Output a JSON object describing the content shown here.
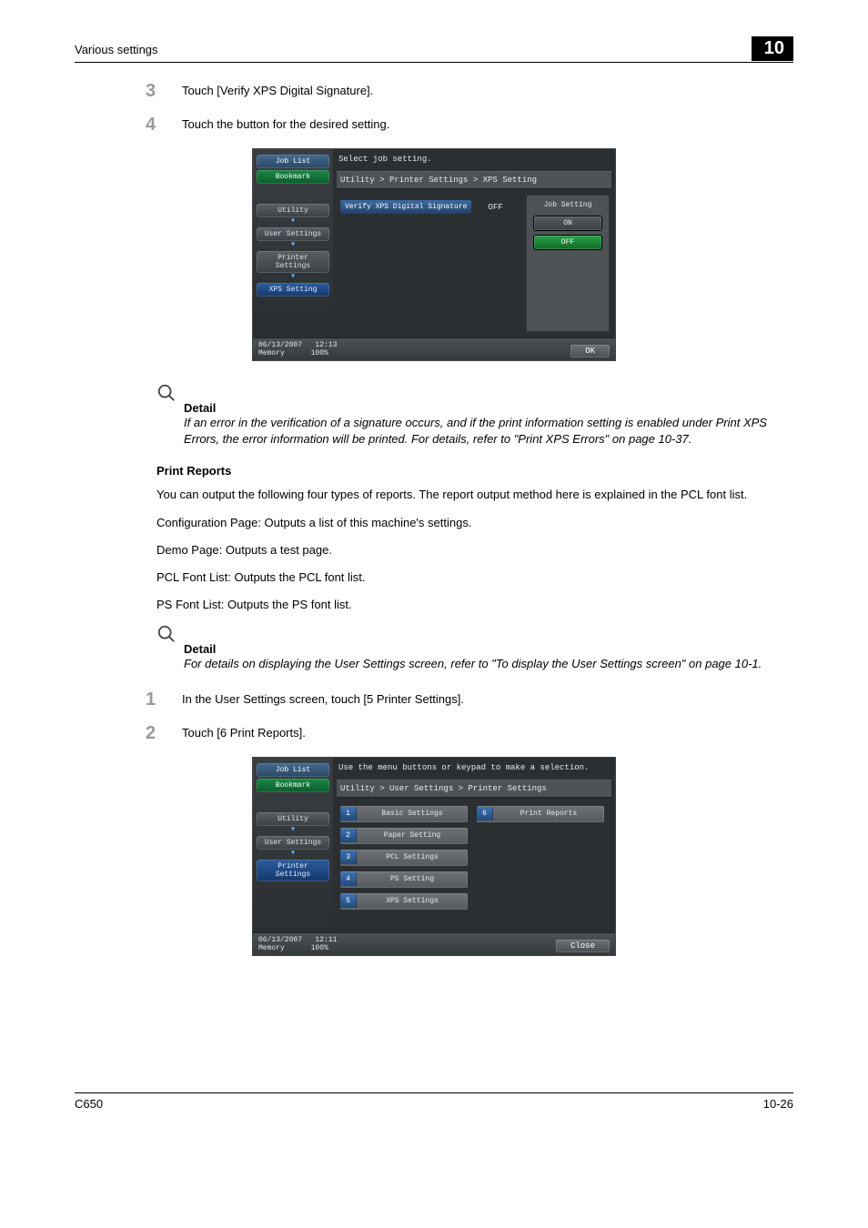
{
  "header": {
    "section": "Various settings",
    "chapter": "10"
  },
  "steps_a": [
    {
      "num": "3",
      "text": "Touch [Verify XPS Digital Signature]."
    },
    {
      "num": "4",
      "text": "Touch the button for the desired setting."
    }
  ],
  "screen1": {
    "tabs": {
      "joblist": "Job List",
      "bookmark": "Bookmark"
    },
    "side": {
      "utility": "Utility",
      "user_settings": "User Settings",
      "printer_settings": "Printer Settings",
      "xps_setting": "XPS Setting"
    },
    "instr": "Select job setting.",
    "breadcrumb": "Utility > Printer Settings > XPS Setting",
    "item_label": "Verify XPS Digital Signature",
    "item_value": "OFF",
    "right_title": "Job Setting",
    "on": "ON",
    "off": "OFF",
    "footer_date": "06/13/2007",
    "footer_time": "12:13",
    "footer_mem_label": "Memory",
    "footer_mem_val": "100%",
    "ok": "OK"
  },
  "detail1": {
    "title": "Detail",
    "body": "If an error in the verification of a signature occurs, and if the print information setting is enabled under Print XPS Errors, the error information will be printed. For details, refer to \"Print XPS Errors\" on page 10-37."
  },
  "print_reports": {
    "title": "Print Reports",
    "intro": "You can output the following four types of reports. The report output method here is explained in the PCL font list.",
    "lines": [
      "Configuration Page: Outputs a list of this machine's settings.",
      "Demo Page: Outputs a test page.",
      "PCL Font List: Outputs the PCL font list.",
      "PS Font List: Outputs the PS font list."
    ]
  },
  "detail2": {
    "title": "Detail",
    "body": "For details on displaying the User Settings screen, refer to \"To display the User Settings screen\" on page 10-1."
  },
  "steps_b": [
    {
      "num": "1",
      "text": "In the User Settings screen, touch [5 Printer Settings]."
    },
    {
      "num": "2",
      "text": "Touch [6 Print Reports]."
    }
  ],
  "screen2": {
    "tabs": {
      "joblist": "Job List",
      "bookmark": "Bookmark"
    },
    "side": {
      "utility": "Utility",
      "user_settings": "User Settings",
      "printer_settings": "Printer Settings"
    },
    "instr": "Use the menu buttons or keypad to make a selection.",
    "breadcrumb": "Utility > User Settings > Printer Settings",
    "menu": [
      {
        "n": "1",
        "lbl": "Basic Settings"
      },
      {
        "n": "2",
        "lbl": "Paper Setting"
      },
      {
        "n": "3",
        "lbl": "PCL Settings"
      },
      {
        "n": "4",
        "lbl": "PS Setting"
      },
      {
        "n": "5",
        "lbl": "XPS Settings"
      }
    ],
    "menu_right": [
      {
        "n": "6",
        "lbl": "Print Reports"
      }
    ],
    "footer_date": "06/13/2007",
    "footer_time": "12:11",
    "footer_mem_label": "Memory",
    "footer_mem_val": "100%",
    "close": "Close"
  },
  "footer": {
    "left": "C650",
    "right": "10-26"
  }
}
